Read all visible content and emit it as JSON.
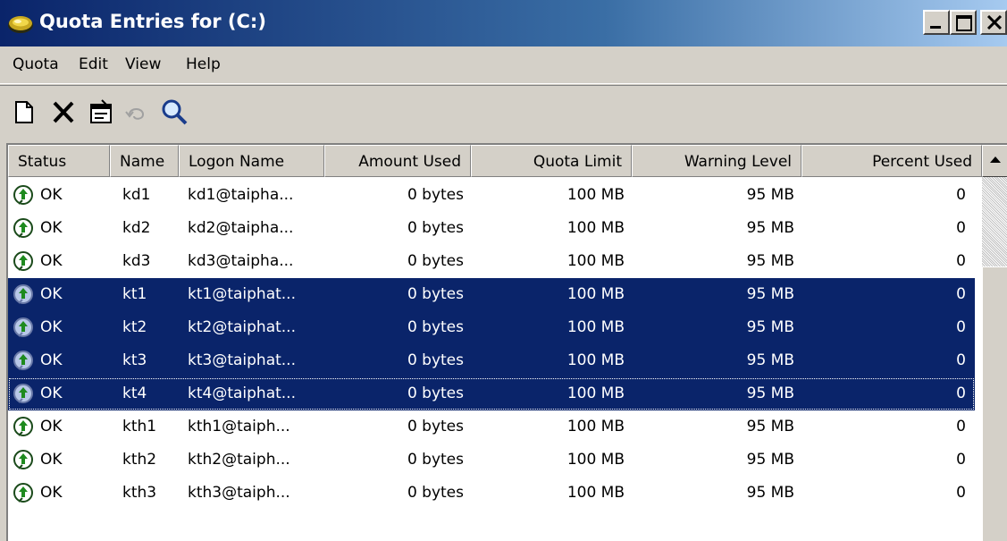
{
  "window": {
    "title": "Quota Entries for  (C:)",
    "icon": "disk-quota-icon"
  },
  "menu": {
    "items": [
      "Quota",
      "Edit",
      "View",
      "Help"
    ]
  },
  "toolbar": {
    "buttons": [
      {
        "name": "new-entry",
        "icon": "new-document-icon"
      },
      {
        "name": "delete",
        "icon": "delete-x-icon"
      },
      {
        "name": "properties",
        "icon": "properties-icon"
      },
      {
        "name": "undo",
        "icon": "undo-icon"
      },
      {
        "name": "find",
        "icon": "magnifier-icon"
      }
    ]
  },
  "table": {
    "columns": [
      "Status",
      "Name",
      "Logon Name",
      "Amount Used",
      "Quota Limit",
      "Warning Level",
      "Percent Used"
    ],
    "rows": [
      {
        "status": "OK",
        "name": "kd1",
        "logon": "kd1@taipha...",
        "amount": "0 bytes",
        "limit": "100 MB",
        "warning": "95 MB",
        "percent": "0",
        "selected": false
      },
      {
        "status": "OK",
        "name": "kd2",
        "logon": "kd2@taipha...",
        "amount": "0 bytes",
        "limit": "100 MB",
        "warning": "95 MB",
        "percent": "0",
        "selected": false
      },
      {
        "status": "OK",
        "name": "kd3",
        "logon": "kd3@taipha...",
        "amount": "0 bytes",
        "limit": "100 MB",
        "warning": "95 MB",
        "percent": "0",
        "selected": false
      },
      {
        "status": "OK",
        "name": "kt1",
        "logon": "kt1@taiphat...",
        "amount": "0 bytes",
        "limit": "100 MB",
        "warning": "95 MB",
        "percent": "0",
        "selected": true
      },
      {
        "status": "OK",
        "name": "kt2",
        "logon": "kt2@taiphat...",
        "amount": "0 bytes",
        "limit": "100 MB",
        "warning": "95 MB",
        "percent": "0",
        "selected": true
      },
      {
        "status": "OK",
        "name": "kt3",
        "logon": "kt3@taiphat...",
        "amount": "0 bytes",
        "limit": "100 MB",
        "warning": "95 MB",
        "percent": "0",
        "selected": true
      },
      {
        "status": "OK",
        "name": "kt4",
        "logon": "kt4@taiphat...",
        "amount": "0 bytes",
        "limit": "100 MB",
        "warning": "95 MB",
        "percent": "0",
        "selected": true
      },
      {
        "status": "OK",
        "name": "kth1",
        "logon": "kth1@taiph...",
        "amount": "0 bytes",
        "limit": "100 MB",
        "warning": "95 MB",
        "percent": "0",
        "selected": false
      },
      {
        "status": "OK",
        "name": "kth2",
        "logon": "kth2@taiph...",
        "amount": "0 bytes",
        "limit": "100 MB",
        "warning": "95 MB",
        "percent": "0",
        "selected": false
      },
      {
        "status": "OK",
        "name": "kth3",
        "logon": "kth3@taiph...",
        "amount": "0 bytes",
        "limit": "100 MB",
        "warning": "95 MB",
        "percent": "0",
        "selected": false
      }
    ]
  },
  "colors": {
    "selection": "#0a246a",
    "titlebar_start": "#0a246a",
    "titlebar_end": "#a6caf0",
    "chrome": "#d4d0c8"
  }
}
